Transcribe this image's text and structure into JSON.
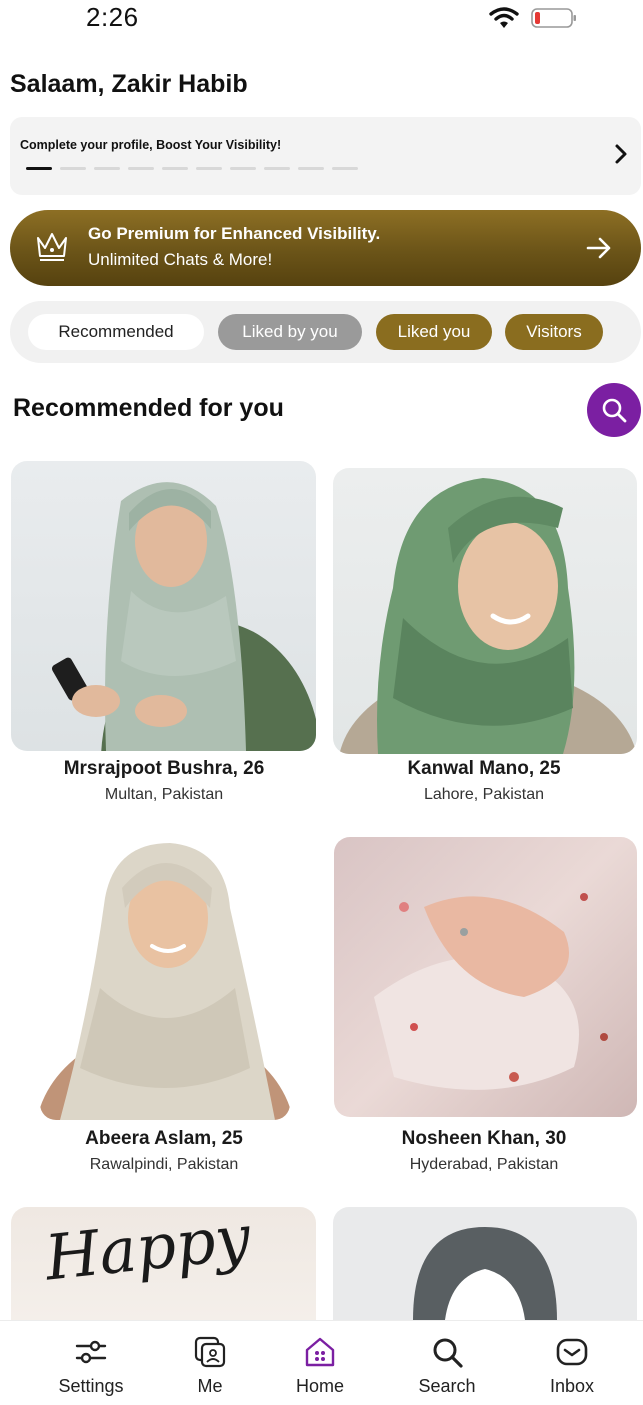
{
  "status_bar": {
    "time": "2:26"
  },
  "greeting": "Salaam, Zakir Habib",
  "profile_prompt": {
    "text": "Complete your profile, Boost Your Visibility!",
    "steps_total": 10,
    "steps_done": 1
  },
  "premium": {
    "line1": "Go Premium for Enhanced Visibility.",
    "line2": "Unlimited Chats & More!",
    "color": "#7a5f1c"
  },
  "tabs": [
    {
      "label": "Recommended"
    },
    {
      "label": "Liked by you"
    },
    {
      "label": "Liked you"
    },
    {
      "label": "Visitors"
    }
  ],
  "section_title": "Recommended for you",
  "profiles": [
    {
      "name": "Mrsrajpoot Bushra, 26",
      "location": "Multan, Pakistan"
    },
    {
      "name": "Kanwal Mano, 25",
      "location": "Lahore, Pakistan"
    },
    {
      "name": "Abeera Aslam, 25",
      "location": "Rawalpindi, Pakistan"
    },
    {
      "name": "Nosheen Khan, 30",
      "location": "Hyderabad, Pakistan"
    }
  ],
  "partial_card_text": "Happy",
  "nav": [
    {
      "label": "Settings",
      "icon": "sliders-icon"
    },
    {
      "label": "Me",
      "icon": "profile-card-icon"
    },
    {
      "label": "Home",
      "icon": "home-icon"
    },
    {
      "label": "Search",
      "icon": "search-icon"
    },
    {
      "label": "Inbox",
      "icon": "inbox-icon"
    }
  ],
  "accent_color": "#7b1fa2"
}
